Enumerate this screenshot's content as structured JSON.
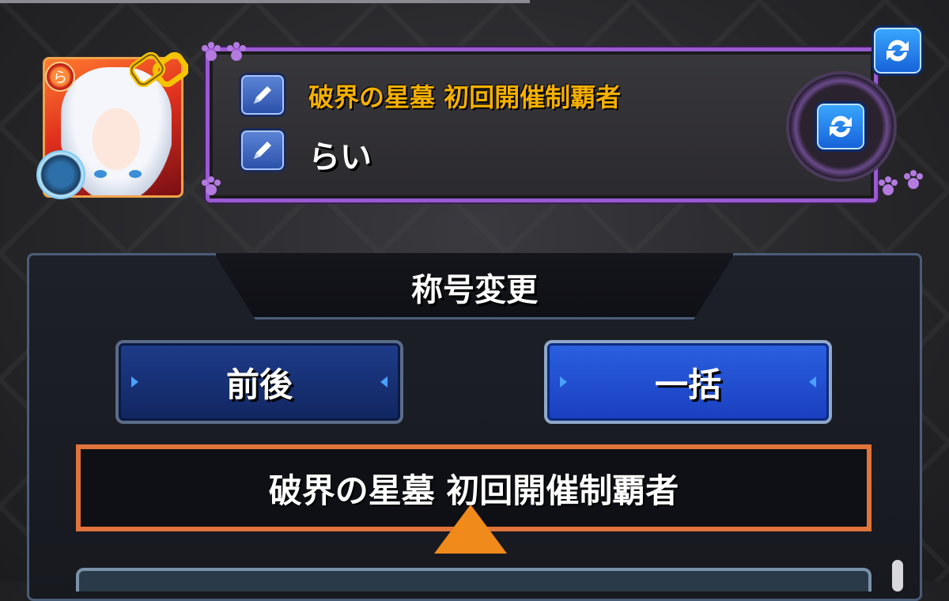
{
  "profile": {
    "title": "破界の星墓 初回開催制覇者",
    "player_name": "らい"
  },
  "panel": {
    "header": "称号変更",
    "tabs": [
      {
        "label": "前後",
        "selected": false
      },
      {
        "label": "一括",
        "selected": true
      }
    ],
    "selected_title": "破界の星墓 初回開催制覇者"
  },
  "icons": {
    "edit": "pencil-icon",
    "refresh": "refresh-icon",
    "chain": "chain-link-icon",
    "element": "fire-element-icon"
  },
  "colors": {
    "title_gold": "#f5b000",
    "frame_purple": "#9a5ad0",
    "selection_orange": "#e0743a",
    "accent_blue": "#2a60e0"
  }
}
